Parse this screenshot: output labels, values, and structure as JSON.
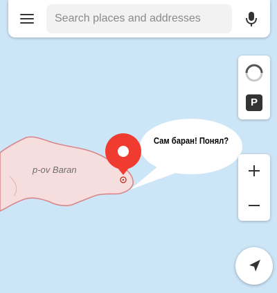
{
  "search": {
    "placeholder": "Search places and addresses"
  },
  "map": {
    "place_label": "p-ov Baran",
    "water_color": "#cce6f8",
    "land_color": "#f7dede",
    "pin_color": "#f03c30"
  },
  "speech_bubble": {
    "text": "Сам баран! Понял?"
  },
  "controls": {
    "parking_label": "P",
    "icons": [
      "menu-icon",
      "microphone-icon",
      "traffic-icon",
      "parking-icon",
      "zoom-in-icon",
      "zoom-out-icon",
      "location-arrow-icon"
    ]
  }
}
